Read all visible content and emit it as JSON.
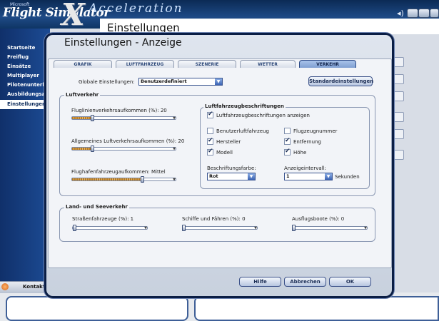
{
  "app": {
    "logo_brand": "Microsoft",
    "logo_title": "Flight Simulator",
    "logo_x": "X",
    "logo_edition": "Acceleration"
  },
  "background": {
    "page_title": "Einstellungen"
  },
  "sidebar": {
    "items": [
      {
        "label": "Startseite",
        "active": false
      },
      {
        "label": "Freiflug",
        "active": false
      },
      {
        "label": "Einsätze",
        "active": false
      },
      {
        "label": "Multiplayer",
        "active": false
      },
      {
        "label": "Pilotenunterlag",
        "active": false
      },
      {
        "label": "Ausbildungsze",
        "active": false
      },
      {
        "label": "Einstellungen",
        "active": true
      }
    ],
    "contacts_label": "Kontakte"
  },
  "dialog": {
    "title": "Einstellungen - Anzeige",
    "tabs": [
      {
        "label": "GRAFIK",
        "active": false
      },
      {
        "label": "LUFTFAHRZEUG",
        "active": false
      },
      {
        "label": "SZENERIE",
        "active": false
      },
      {
        "label": "WETTER",
        "active": false
      },
      {
        "label": "VERKEHR",
        "active": true
      }
    ],
    "global_settings_label": "Globale Einstellungen:",
    "global_settings_value": "Benutzerdefiniert",
    "defaults_button": "Standardeinstellungen",
    "air_traffic": {
      "title": "Luftverkehr",
      "airline_label": "Fluglinienverkehrsaufkommen (%): 20",
      "airline_value": 0.2,
      "general_label": "Allgemeines Luftverkehrsaufkommen (%): 20",
      "general_value": 0.2,
      "airport_label": "Flughafenfahrzeugaufkommen: Mittel",
      "airport_value": 0.72
    },
    "aircraft_labels": {
      "title": "Luftfahrzeugbeschriftungen",
      "show_label": "Luftfahrzeugbeschriftungen anzeigen",
      "show_checked": true,
      "user_aircraft": "Benutzerluftfahrzeug",
      "user_aircraft_checked": false,
      "flight_number": "Flugzeugnummer",
      "flight_number_checked": false,
      "manufacturer": "Hersteller",
      "manufacturer_checked": true,
      "distance": "Entfernung",
      "distance_checked": true,
      "model": "Modell",
      "model_checked": true,
      "altitude": "Höhe",
      "altitude_checked": true,
      "color_label": "Beschriftungsfarbe:",
      "color_value": "Rot",
      "interval_label": "Anzeigeintervall:",
      "interval_value": "1",
      "interval_unit": "Sekunden"
    },
    "land_sea": {
      "title": "Land- und Seeverkehr",
      "road_label": "Straßenfahrzeuge (%): 1",
      "road_value": 0.01,
      "ships_label": "Schiffe und Fähren (%): 0",
      "ships_value": 0,
      "boats_label": "Ausflugsboote (%): 0",
      "boats_value": 0
    },
    "buttons": {
      "help": "Hilfe",
      "cancel": "Abbrechen",
      "ok": "OK"
    }
  },
  "colors": {
    "frame_dark": "#0a1d44",
    "sidebar_blue": "#1c4b94",
    "accent_tab": "#7f9fd1",
    "slider_fill": "#b77a20"
  }
}
